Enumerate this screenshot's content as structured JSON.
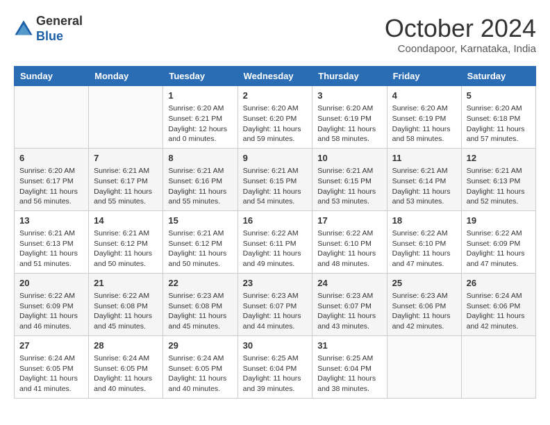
{
  "header": {
    "logo_line1": "General",
    "logo_line2": "Blue",
    "month": "October 2024",
    "location": "Coondapoor, Karnataka, India"
  },
  "days_of_week": [
    "Sunday",
    "Monday",
    "Tuesday",
    "Wednesday",
    "Thursday",
    "Friday",
    "Saturday"
  ],
  "weeks": [
    [
      {
        "day": "",
        "info": ""
      },
      {
        "day": "",
        "info": ""
      },
      {
        "day": "1",
        "info": "Sunrise: 6:20 AM\nSunset: 6:21 PM\nDaylight: 12 hours and 0 minutes."
      },
      {
        "day": "2",
        "info": "Sunrise: 6:20 AM\nSunset: 6:20 PM\nDaylight: 11 hours and 59 minutes."
      },
      {
        "day": "3",
        "info": "Sunrise: 6:20 AM\nSunset: 6:19 PM\nDaylight: 11 hours and 58 minutes."
      },
      {
        "day": "4",
        "info": "Sunrise: 6:20 AM\nSunset: 6:19 PM\nDaylight: 11 hours and 58 minutes."
      },
      {
        "day": "5",
        "info": "Sunrise: 6:20 AM\nSunset: 6:18 PM\nDaylight: 11 hours and 57 minutes."
      }
    ],
    [
      {
        "day": "6",
        "info": "Sunrise: 6:20 AM\nSunset: 6:17 PM\nDaylight: 11 hours and 56 minutes."
      },
      {
        "day": "7",
        "info": "Sunrise: 6:21 AM\nSunset: 6:17 PM\nDaylight: 11 hours and 55 minutes."
      },
      {
        "day": "8",
        "info": "Sunrise: 6:21 AM\nSunset: 6:16 PM\nDaylight: 11 hours and 55 minutes."
      },
      {
        "day": "9",
        "info": "Sunrise: 6:21 AM\nSunset: 6:15 PM\nDaylight: 11 hours and 54 minutes."
      },
      {
        "day": "10",
        "info": "Sunrise: 6:21 AM\nSunset: 6:15 PM\nDaylight: 11 hours and 53 minutes."
      },
      {
        "day": "11",
        "info": "Sunrise: 6:21 AM\nSunset: 6:14 PM\nDaylight: 11 hours and 53 minutes."
      },
      {
        "day": "12",
        "info": "Sunrise: 6:21 AM\nSunset: 6:13 PM\nDaylight: 11 hours and 52 minutes."
      }
    ],
    [
      {
        "day": "13",
        "info": "Sunrise: 6:21 AM\nSunset: 6:13 PM\nDaylight: 11 hours and 51 minutes."
      },
      {
        "day": "14",
        "info": "Sunrise: 6:21 AM\nSunset: 6:12 PM\nDaylight: 11 hours and 50 minutes."
      },
      {
        "day": "15",
        "info": "Sunrise: 6:21 AM\nSunset: 6:12 PM\nDaylight: 11 hours and 50 minutes."
      },
      {
        "day": "16",
        "info": "Sunrise: 6:22 AM\nSunset: 6:11 PM\nDaylight: 11 hours and 49 minutes."
      },
      {
        "day": "17",
        "info": "Sunrise: 6:22 AM\nSunset: 6:10 PM\nDaylight: 11 hours and 48 minutes."
      },
      {
        "day": "18",
        "info": "Sunrise: 6:22 AM\nSunset: 6:10 PM\nDaylight: 11 hours and 47 minutes."
      },
      {
        "day": "19",
        "info": "Sunrise: 6:22 AM\nSunset: 6:09 PM\nDaylight: 11 hours and 47 minutes."
      }
    ],
    [
      {
        "day": "20",
        "info": "Sunrise: 6:22 AM\nSunset: 6:09 PM\nDaylight: 11 hours and 46 minutes."
      },
      {
        "day": "21",
        "info": "Sunrise: 6:22 AM\nSunset: 6:08 PM\nDaylight: 11 hours and 45 minutes."
      },
      {
        "day": "22",
        "info": "Sunrise: 6:23 AM\nSunset: 6:08 PM\nDaylight: 11 hours and 45 minutes."
      },
      {
        "day": "23",
        "info": "Sunrise: 6:23 AM\nSunset: 6:07 PM\nDaylight: 11 hours and 44 minutes."
      },
      {
        "day": "24",
        "info": "Sunrise: 6:23 AM\nSunset: 6:07 PM\nDaylight: 11 hours and 43 minutes."
      },
      {
        "day": "25",
        "info": "Sunrise: 6:23 AM\nSunset: 6:06 PM\nDaylight: 11 hours and 42 minutes."
      },
      {
        "day": "26",
        "info": "Sunrise: 6:24 AM\nSunset: 6:06 PM\nDaylight: 11 hours and 42 minutes."
      }
    ],
    [
      {
        "day": "27",
        "info": "Sunrise: 6:24 AM\nSunset: 6:05 PM\nDaylight: 11 hours and 41 minutes."
      },
      {
        "day": "28",
        "info": "Sunrise: 6:24 AM\nSunset: 6:05 PM\nDaylight: 11 hours and 40 minutes."
      },
      {
        "day": "29",
        "info": "Sunrise: 6:24 AM\nSunset: 6:05 PM\nDaylight: 11 hours and 40 minutes."
      },
      {
        "day": "30",
        "info": "Sunrise: 6:25 AM\nSunset: 6:04 PM\nDaylight: 11 hours and 39 minutes."
      },
      {
        "day": "31",
        "info": "Sunrise: 6:25 AM\nSunset: 6:04 PM\nDaylight: 11 hours and 38 minutes."
      },
      {
        "day": "",
        "info": ""
      },
      {
        "day": "",
        "info": ""
      }
    ]
  ]
}
